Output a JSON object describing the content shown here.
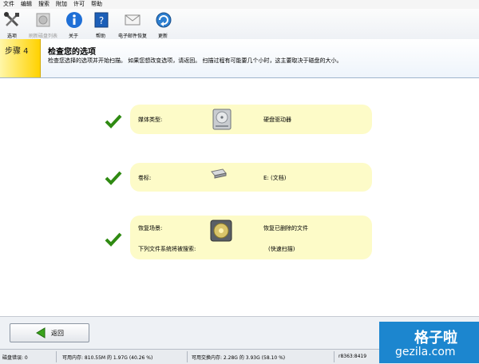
{
  "menu": [
    "文件",
    "编辑",
    "搜索",
    "附加",
    "许可",
    "帮助"
  ],
  "toolbar": {
    "options": "选项",
    "refresh_disks": "刷新磁盘列表",
    "about": "关于",
    "help": "帮助",
    "email_support": "电子邮件恢复",
    "update": "更新"
  },
  "header": {
    "step_label": "步骤 4",
    "title": "检查您的选项",
    "description": "检查您选择的选项并开始扫描。 如果您想改变选项，请返回。 扫描过程有可能要几个小时，这主要取决于磁盘的大小。"
  },
  "options": [
    {
      "label": "媒体类型:",
      "value": "硬盘驱动器",
      "icon": "hard-drive-icon"
    },
    {
      "label": "卷标:",
      "value": "E: (文档)",
      "icon": "volume-drive-icon"
    },
    {
      "label": "恢复场景:",
      "value": "恢复已删除的文件",
      "icon": "recovery-scenario-icon",
      "sub_label": "下列文件系统将被搜索:",
      "sub_value": "(快速扫描)"
    }
  ],
  "buttons": {
    "back": "返回"
  },
  "status": {
    "disk_errors": "磁盘错误: 0",
    "available_memory": "可用内存: 810.55M 的 1.97G (40.26 %)",
    "available_swap": "可用交换内存: 2.28G 的 3.93G (58.10 %)",
    "build": "r8363:8419"
  },
  "watermark": {
    "title": "格子啦",
    "url": "gezila.com"
  },
  "colors": {
    "accent_step": "#ffd200",
    "card": "#fdfbc8",
    "check": "#2f8a12"
  }
}
